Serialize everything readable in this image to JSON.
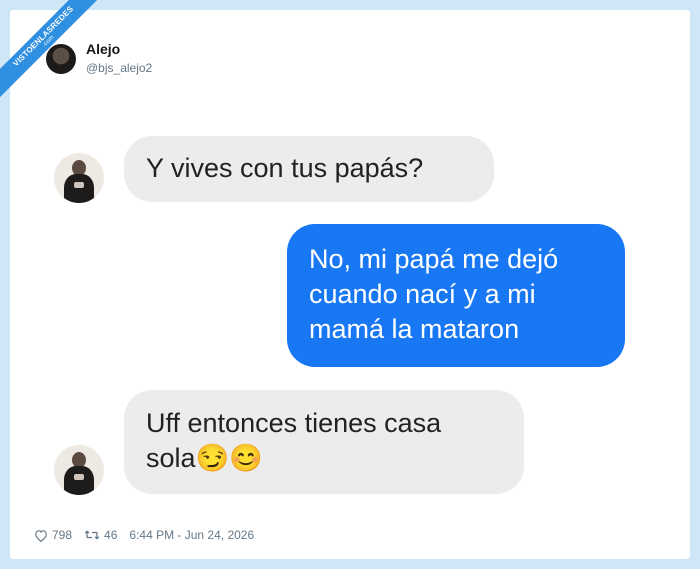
{
  "watermark": {
    "line1": "VISTOENLASREDES",
    "line2": ".com"
  },
  "tweet": {
    "author_name": "Alejo",
    "author_handle": "@bjs_alejo2",
    "likes": "798",
    "retweets": "46",
    "timestamp": "6:44 PM - Jun 24, 2026"
  },
  "chat": {
    "messages": [
      {
        "from": "other",
        "text": "Y vives con tus papás?"
      },
      {
        "from": "me",
        "text": "No, mi papá me dejó\ncuando nací y a mi\nmamá la mataron"
      },
      {
        "from": "other",
        "text": "Uff entonces tienes casa\nsola😏😊"
      }
    ]
  },
  "icons": {
    "like": "heart-icon",
    "retweet": "retweet-icon"
  },
  "colors": {
    "outgoing_bubble": "#1877f2",
    "incoming_bubble": "#ececec",
    "page_background": "#cfe6f7",
    "watermark": "#2f8fe0"
  }
}
